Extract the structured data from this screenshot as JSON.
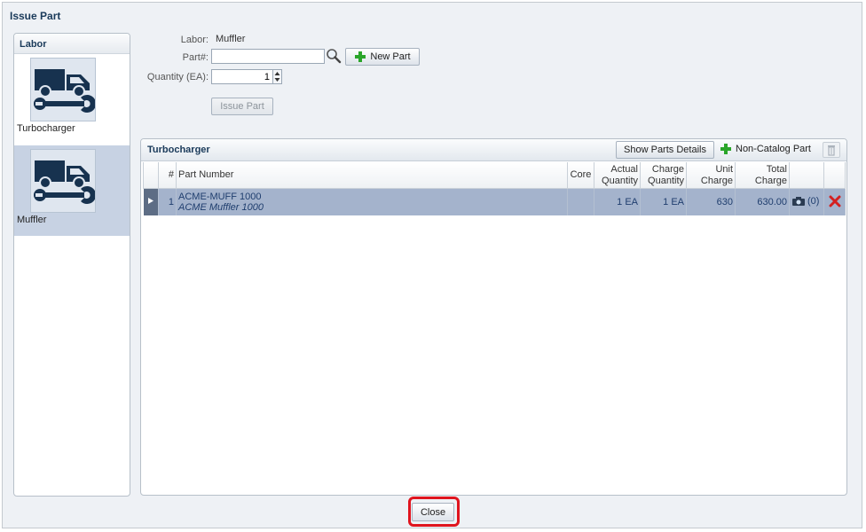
{
  "window": {
    "title": "Issue Part"
  },
  "labor": {
    "header": "Labor",
    "items": [
      {
        "label": "Turbocharger",
        "icon": "truck-wrench-icon",
        "selected": false
      },
      {
        "label": "Muffler",
        "icon": "truck-wrench-icon",
        "selected": true
      }
    ]
  },
  "form": {
    "labor_label": "Labor:",
    "labor_value": "Muffler",
    "part_label": "Part#:",
    "part_value": "",
    "quantity_label": "Quantity (EA):",
    "quantity_value": "1",
    "new_part_label": "New Part",
    "issue_part_label": "Issue Part"
  },
  "parts": {
    "title": "Turbocharger",
    "show_details_label": "Show Parts Details",
    "non_catalog_label": "Non-Catalog Part",
    "columns": [
      "#",
      "Part Number",
      "Core",
      "Actual Quantity",
      "Charge Quantity",
      "Unit Charge",
      "Total Charge"
    ],
    "rows": [
      {
        "index": "1",
        "part_number": "ACME-MUFF 1000",
        "description": "ACME Muffler 1000",
        "core": "",
        "actual_quantity": "1 EA",
        "charge_quantity": "1 EA",
        "unit_charge": "630",
        "total_charge": "630.00",
        "photo_count": "(0)"
      }
    ]
  },
  "footer": {
    "close_label": "Close"
  },
  "colors": {
    "selection": "#a4b3cc",
    "highlight": "#e0141e",
    "add_icon": "#2aa52a",
    "delete_icon": "#d42020"
  }
}
